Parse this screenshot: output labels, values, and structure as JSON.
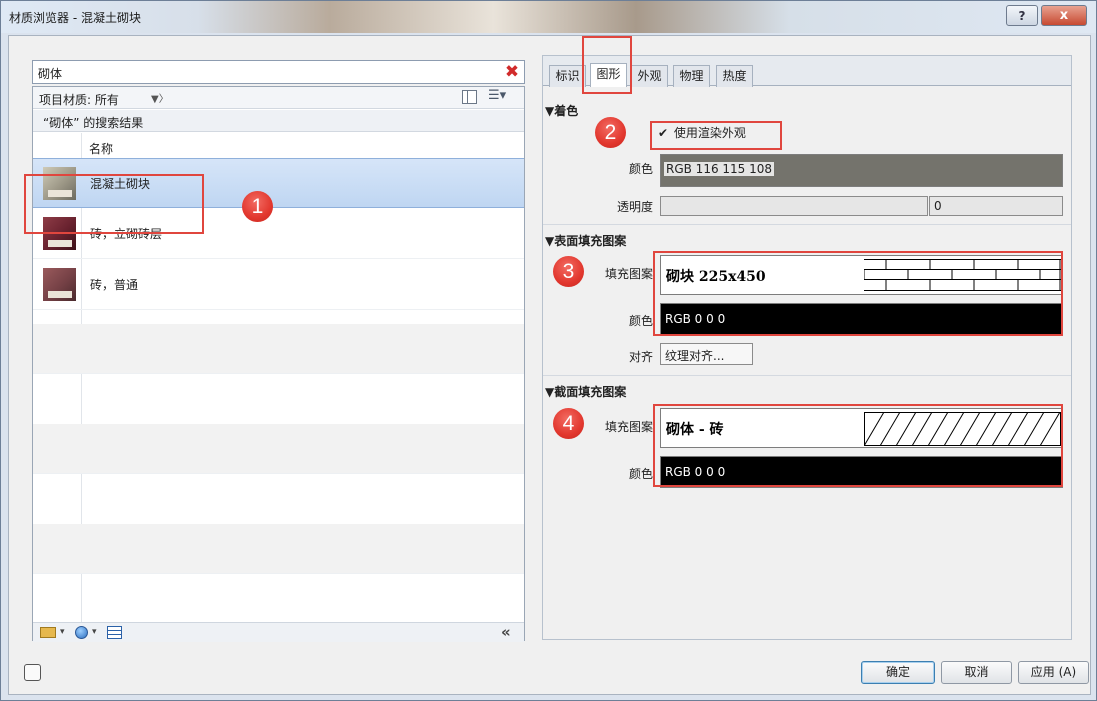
{
  "window": {
    "title": "材质浏览器 - 混凝土砌块",
    "help": "?",
    "close": "x"
  },
  "search": {
    "value": "砌体",
    "clear": "✖"
  },
  "filter": {
    "label": "项目材质: 所有",
    "caret": "▼〉"
  },
  "results_label": "“砌体” 的搜索结果",
  "column_header": "名称",
  "materials": [
    {
      "name": "混凝土砌块",
      "selected": true
    },
    {
      "name": "砖，立砌砖层",
      "selected": false
    },
    {
      "name": "砖，普通",
      "selected": false
    }
  ],
  "footer": {
    "collapse": "«"
  },
  "tabs": [
    "标识",
    "图形",
    "外观",
    "物理",
    "热度"
  ],
  "active_tab": "图形",
  "shading": {
    "title": "▼着色",
    "use_render_label": "使用渲染外观",
    "checked": "✔",
    "color_label": "颜色",
    "color_value": "RGB 116 115 108",
    "color_hex": "#74736c",
    "transparency_label": "透明度",
    "transparency_value": "0"
  },
  "surface": {
    "title": "▼表面填充图案",
    "pattern_label": "填充图案",
    "pattern_value": "砌块 225x450",
    "color_label": "颜色",
    "color_value": "RGB 0 0 0",
    "align_label": "对齐",
    "align_button": "纹理对齐..."
  },
  "cut": {
    "title": "▼截面填充图案",
    "pattern_label": "填充图案",
    "pattern_value": "砌体 - 砖",
    "color_label": "颜色",
    "color_value": "RGB 0 0 0"
  },
  "callouts": [
    "1",
    "2",
    "3",
    "4"
  ],
  "buttons": {
    "ok": "确定",
    "cancel": "取消",
    "apply": "应用 (A)"
  },
  "colors": {
    "callout": "#e2372e",
    "selection": "#bfd6f2"
  }
}
